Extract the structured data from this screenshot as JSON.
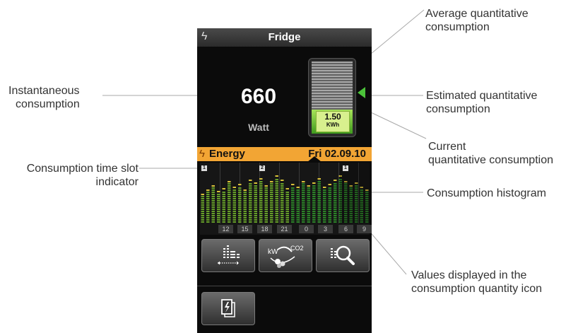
{
  "annotations": {
    "average": "Average quantitative consumption",
    "average_line1": "Average quantitative",
    "average_line2": "consumption",
    "instantaneous_line1": "Instantaneous",
    "instantaneous_line2": "consumption",
    "estimated_line1": "Estimated quantitative",
    "estimated_line2": "consumption",
    "current_line1": "Current",
    "current_line2": "quantitative consumption",
    "timeslot_line1": "Consumption time slot",
    "timeslot_line2": "indicator",
    "histogram": "Consumption histogram",
    "values_line1": "Values displayed in the",
    "values_line2": "consumption quantity icon"
  },
  "device": {
    "title": "Fridge",
    "power_value": "660",
    "power_unit": "Watt",
    "gauge_value": "1.50",
    "gauge_unit": "KWh",
    "gauge_fill_fraction": 0.33,
    "energy_label": "Energy",
    "date": "Fri 02.09.10",
    "hours": [
      "12",
      "15",
      "18",
      "21",
      "0",
      "3",
      "6",
      "9"
    ],
    "slot_badges": [
      "1",
      "2",
      "1"
    ],
    "buttons": {
      "histogram_icon": "histogram-icon",
      "kw_co2_icon": "kw-co2-icon",
      "zoom_icon": "zoom-icon",
      "copy_icon": "copy-energy-icon",
      "kw_label": "kW",
      "co2_label": "CO2"
    }
  },
  "colors": {
    "accent_orange": "#f2a534",
    "green": "#4cc33a",
    "yellow": "#d9c13a"
  }
}
